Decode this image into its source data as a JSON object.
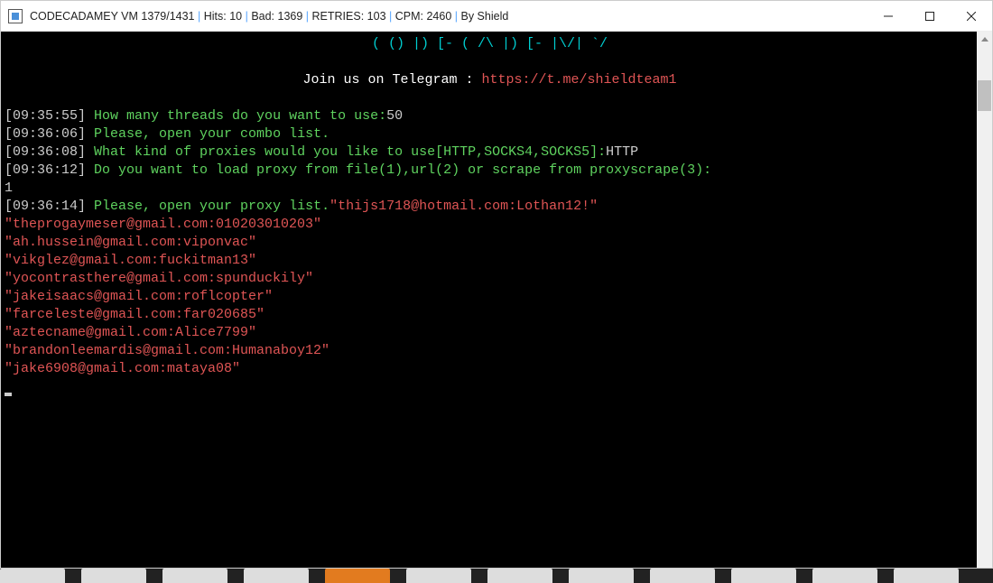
{
  "title": {
    "app": "CODECADAMEY VM",
    "counter": "1379/1431",
    "hits_label": "Hits:",
    "hits": "10",
    "bad_label": "Bad:",
    "bad": "1369",
    "retries_label": "RETRIES:",
    "retries": "103",
    "cpm_label": "CPM:",
    "cpm": "2460",
    "by": "By Shield",
    "sep": " | "
  },
  "banner": {
    "ascii": "( () |) [- ( /\\ |) [- |\\/| `/",
    "join_label": "Join us on Telegram : ",
    "join_url": "https://t.me/shieldteam1"
  },
  "lines": [
    {
      "ts": "[09:35:55]",
      "prompt": "How many threads do you want to use:",
      "answer": "50"
    },
    {
      "ts": "[09:36:06]",
      "prompt": "Please, open your combo list.",
      "answer": ""
    },
    {
      "ts": "[09:36:08]",
      "prompt": "What kind of proxies would you like to use[HTTP,SOCKS4,SOCKS5]:",
      "answer": "HTTP"
    },
    {
      "ts": "[09:36:12]",
      "prompt": "Do you want to load proxy from file(1),url(2) or scrape from proxyscrape(3):",
      "answer_next_line": "1"
    },
    {
      "ts": "[09:36:14]",
      "prompt": "Please, open your proxy list.",
      "trailing_red": "\"thijs1718@hotmail.com:Lothan12!\""
    }
  ],
  "red_lines": [
    "\"theprogaymeser@gmail.com:010203010203\"",
    "\"ah.hussein@gmail.com:viponvac\"",
    "\"vikglez@gmail.com:fuckitman13\"",
    "\"yocontrasthere@gmail.com:spunduckily\"",
    "\"jakeisaacs@gmail.com:roflcopter\"",
    "\"farceleste@gmail.com:far020685\"",
    "\"aztecname@gmail.com:Alice7799\"",
    "\"brandonleemardis@gmail.com:Humanaboy12\"",
    "\"jake6908@gmail.com:mataya08\""
  ]
}
